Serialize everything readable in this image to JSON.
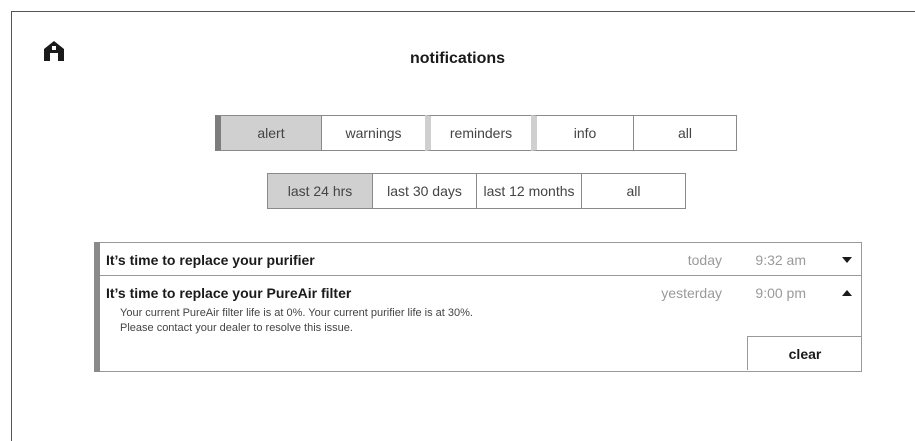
{
  "header": {
    "title": "notifications",
    "home_icon": "home-icon"
  },
  "category_tabs": [
    {
      "label": "alert",
      "active": true
    },
    {
      "label": "warnings",
      "active": false
    },
    {
      "label": "reminders",
      "active": false
    },
    {
      "label": "info",
      "active": false
    },
    {
      "label": "all",
      "active": false
    }
  ],
  "time_tabs": [
    {
      "label": "last 24 hrs",
      "active": true
    },
    {
      "label": "last 30 days",
      "active": false
    },
    {
      "label": "last 12 months",
      "active": false
    },
    {
      "label": "all",
      "active": false
    }
  ],
  "notifications": [
    {
      "title": "It’s time to replace your purifier",
      "day": "today",
      "time": "9:32 am",
      "expanded": false
    },
    {
      "title": "It’s time to replace your PureAir filter",
      "day": "yesterday",
      "time": "9:00 pm",
      "expanded": true,
      "detail_line1": "Your current PureAir filter life is at 0%. Your current purifier life is at 30%.",
      "detail_line2": "Please contact your dealer to resolve this issue.",
      "clear_label": "clear"
    }
  ],
  "colors": {
    "active_tab": "#d0d0d0",
    "accent_bar": "#7d7d7d",
    "muted_text": "#9a9a9a"
  }
}
